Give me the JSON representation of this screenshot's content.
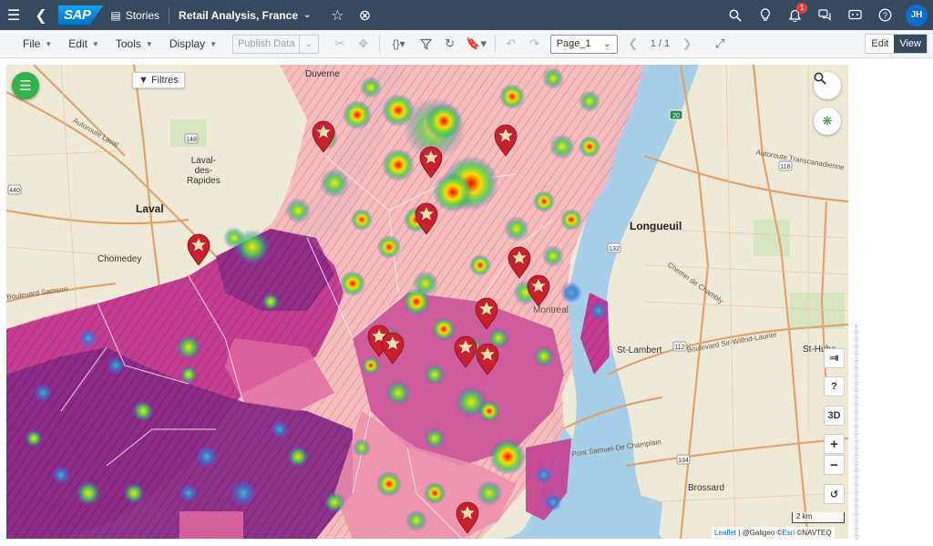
{
  "shell": {
    "app": "Stories",
    "logo": "SAP",
    "story_title": "Retail Analysis, France",
    "notification_count": "1",
    "user_initials": "JH"
  },
  "toolbar": {
    "menus": [
      "File",
      "Edit",
      "Tools",
      "Display"
    ],
    "publish_label": "Publish Data",
    "page_select": "Page_1",
    "page_info": "1 / 1",
    "edit_label": "Edit",
    "view_label": "View"
  },
  "map": {
    "filter_button": "Filtres",
    "controls": {
      "share": "share-icon",
      "help": "?",
      "three_d": "3D",
      "zoom_in": "+",
      "zoom_out": "−",
      "reset": "reset-icon"
    },
    "scale_label": "2 km",
    "attribution": {
      "leaflet": "Leaflet",
      "credit": "| @Galigeo ©",
      "esri": "Esri",
      "navteq": "©NAVTEQ"
    },
    "places": {
      "laval": "Laval",
      "longueuil": "Longueuil",
      "chomedey": "Chomedey",
      "laval_des_rapides": "Laval-\ndes-\nRapides",
      "duvernay": "Duverne",
      "st_lambert": "St-Lambert",
      "brossard": "Brossard",
      "st_hubert": "St-Hube",
      "montreal": "Montreal"
    },
    "roads": {
      "autoroute_laval": "Autoroute Laval",
      "boulevard_sir_wilfrid": "Boulevard Sir-Wilfrid-Laurier",
      "chemin_chambly": "Chemin de Chambly",
      "autoroute_transcanadienne": "Autoroute Transcanadienne",
      "pont_champlain": "Pont Samuel-De Champlain",
      "boulevard_samson": "Boulevard Samson"
    },
    "route_shields": [
      "440",
      "148",
      "132",
      "112",
      "134",
      "116",
      "20"
    ]
  }
}
